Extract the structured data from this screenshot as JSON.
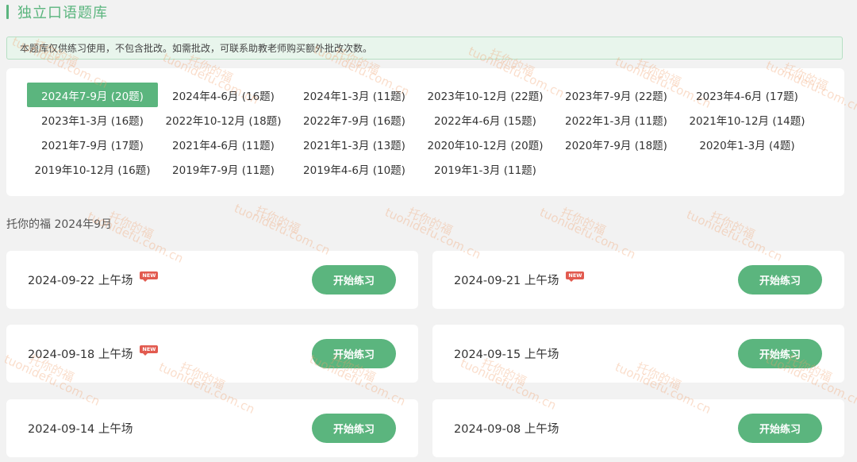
{
  "page_title": "独立口语题库",
  "notice": "本题库仅供练习使用，不包含批改。如需批改，可联系助教老师购买额外批改次数。",
  "question_banks": [
    {
      "label": "2024年7-9月 (20题)",
      "active": true
    },
    {
      "label": "2024年4-6月 (16题)"
    },
    {
      "label": "2024年1-3月 (11题)"
    },
    {
      "label": "2023年10-12月 (22题)"
    },
    {
      "label": "2023年7-9月 (22题)"
    },
    {
      "label": "2023年4-6月 (17题)"
    },
    {
      "label": "2023年1-3月 (16题)"
    },
    {
      "label": "2022年10-12月 (18题)"
    },
    {
      "label": "2022年7-9月 (16题)"
    },
    {
      "label": "2022年4-6月 (15题)"
    },
    {
      "label": "2022年1-3月 (11题)"
    },
    {
      "label": "2021年10-12月 (14题)"
    },
    {
      "label": "2021年7-9月 (17题)"
    },
    {
      "label": "2021年4-6月 (11题)"
    },
    {
      "label": "2021年1-3月 (13题)"
    },
    {
      "label": "2020年10-12月 (20题)"
    },
    {
      "label": "2020年7-9月 (18题)"
    },
    {
      "label": "2020年1-3月 (4题)"
    },
    {
      "label": "2019年10-12月 (16题)"
    },
    {
      "label": "2019年7-9月 (11题)"
    },
    {
      "label": "2019年4-6月 (10题)"
    },
    {
      "label": "2019年1-3月 (11题)"
    }
  ],
  "section_label": "托你的福 2024年9月",
  "sessions": [
    {
      "label": "2024-09-22 上午场",
      "new": true,
      "button": "开始练习"
    },
    {
      "label": "2024-09-21 上午场",
      "new": true,
      "button": "开始练习"
    },
    {
      "label": "2024-09-18 上午场",
      "new": true,
      "button": "开始练习"
    },
    {
      "label": "2024-09-15 上午场",
      "new": false,
      "button": "开始练习"
    },
    {
      "label": "2024-09-14 上午场",
      "new": false,
      "button": "开始练习"
    },
    {
      "label": "2024-09-08 上午场",
      "new": false,
      "button": "开始练习"
    }
  ],
  "new_badge_text": "NEW",
  "watermark": {
    "name": "托你的福",
    "url": "tuonidefu.com.cn"
  },
  "colors": {
    "accent": "#5bb57e",
    "badge": "#e25a4f",
    "notice_bg": "#e8f5ec",
    "page_bg": "#f2f2f2"
  }
}
